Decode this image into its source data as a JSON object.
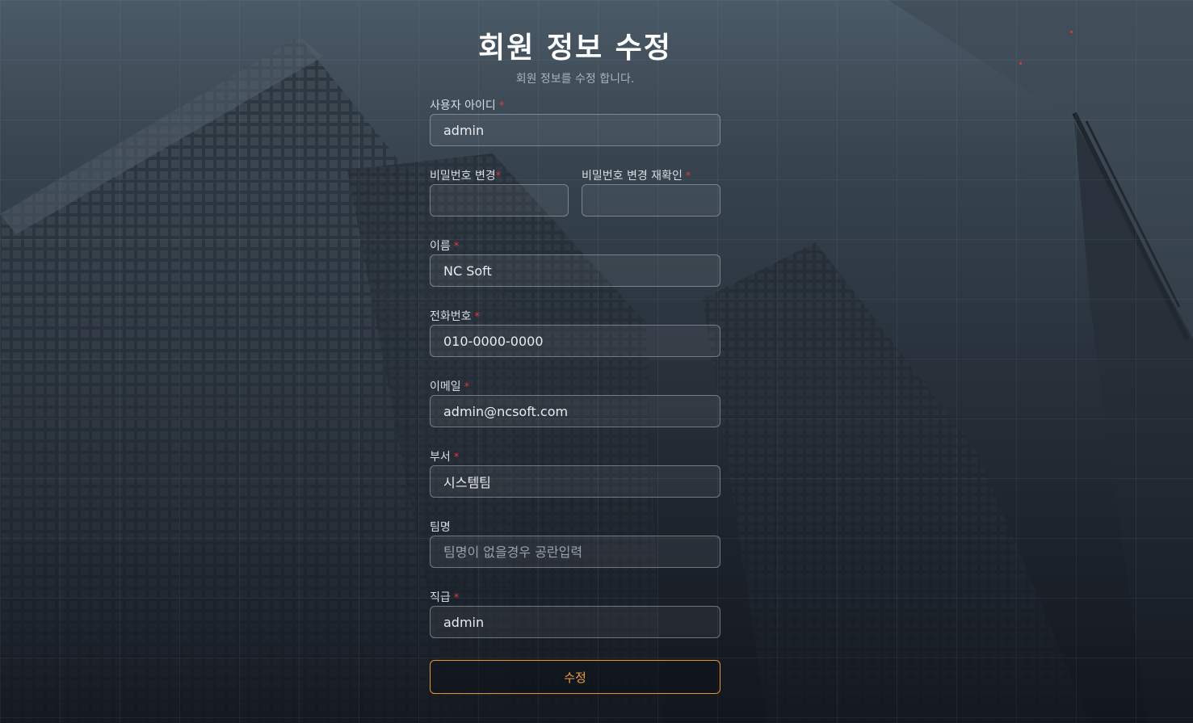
{
  "header": {
    "title": "회원 정보 수정",
    "subtitle": "회원 정보를 수정 합니다."
  },
  "form": {
    "user_id": {
      "label": "사용자 아이디",
      "value": "admin",
      "required": true
    },
    "password": {
      "label": "비밀번호 변경",
      "value": "",
      "required": true
    },
    "password_confirm": {
      "label": "비밀번호 변경 재확인",
      "value": "",
      "required": true
    },
    "name": {
      "label": "이름",
      "value": "NC Soft",
      "required": true
    },
    "phone": {
      "label": "전화번호",
      "value": "010-0000-0000",
      "required": true
    },
    "email": {
      "label": "이메일",
      "value": "admin@ncsoft.com",
      "required": true
    },
    "department": {
      "label": "부서",
      "value": "시스템팀",
      "required": true
    },
    "team": {
      "label": "팀명",
      "value": "",
      "placeholder": "팀명이 없을경우 공란입력",
      "required": false
    },
    "position": {
      "label": "직급",
      "value": "admin",
      "required": true
    },
    "required_mark": "*",
    "submit_label": "수정"
  },
  "colors": {
    "accent": "#e5962f",
    "required": "#e23a3a",
    "background_top": "#4a5a66",
    "background_bottom": "#12161e"
  }
}
